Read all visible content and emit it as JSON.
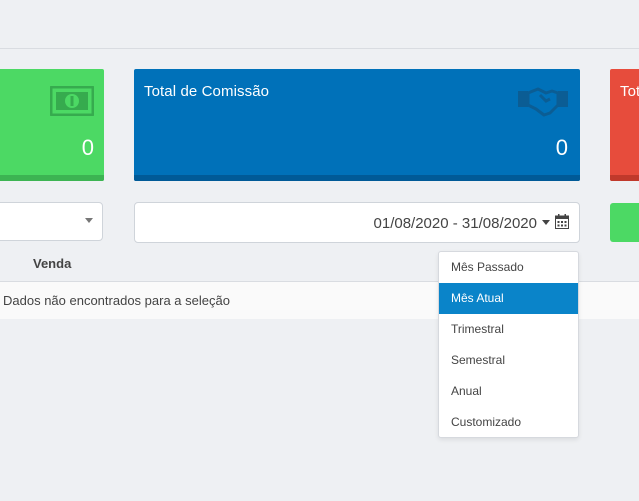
{
  "cards": [
    {
      "title": "",
      "value": "0",
      "icon": "money-bill-icon"
    },
    {
      "title": "Total de Comissão",
      "value": "0",
      "icon": "handshake-icon"
    },
    {
      "title": "Tot",
      "value": ""
    }
  ],
  "filters": {
    "date_range": "01/08/2020 - 31/08/2020"
  },
  "table": {
    "columns": [
      "Venda"
    ],
    "empty_message": "Dados não encontrados para a seleção"
  },
  "date_dropdown": {
    "items": [
      {
        "label": "Mês Passado",
        "active": false
      },
      {
        "label": "Mês Atual",
        "active": true
      },
      {
        "label": "Trimestral",
        "active": false
      },
      {
        "label": "Semestral",
        "active": false
      },
      {
        "label": "Anual",
        "active": false
      },
      {
        "label": "Customizado",
        "active": false
      }
    ]
  },
  "colors": {
    "green": "#4cd964",
    "blue": "#0071b9",
    "red": "#e74c3c",
    "active_item": "#0a84c9"
  }
}
